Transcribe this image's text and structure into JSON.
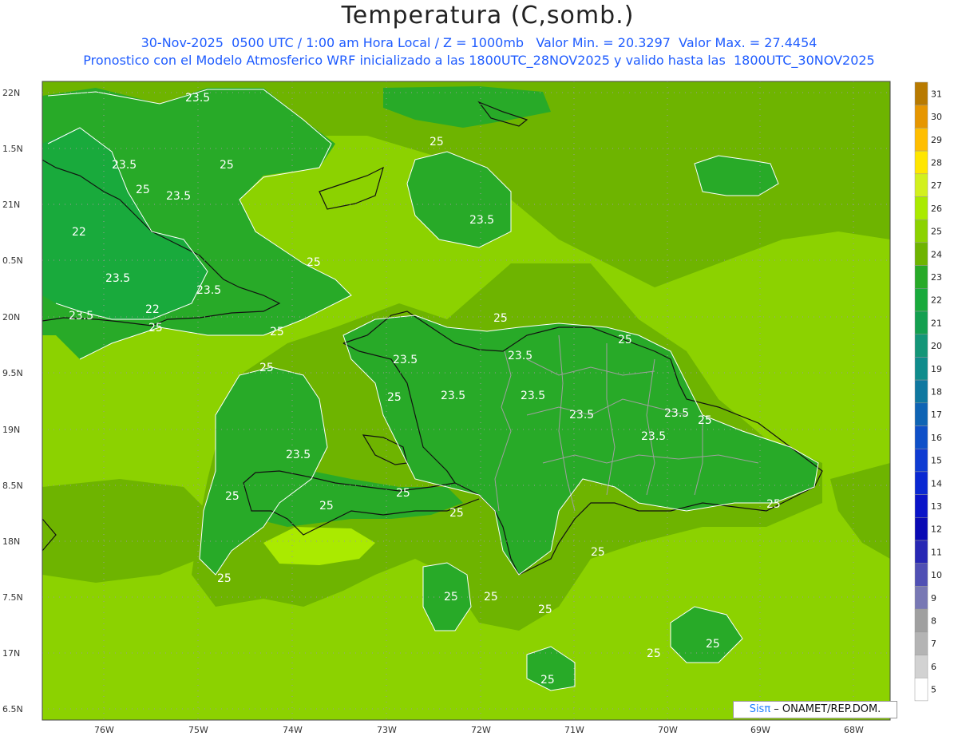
{
  "header": {
    "title": "Temperatura (C,somb.)",
    "line1": "30-Nov-2025  0500 UTC / 1:00 am Hora Local / Z = 1000mb   Valor Min. = 20.3297  Valor Max. = 27.4454",
    "line2": "Pronostico con el Modelo Atmosferico WRF inicializado a las 1800UTC_28NOV2025 y valido hasta las  1800UTC_30NOV2025"
  },
  "axes": {
    "lat_labels": [
      "22N",
      "1.5N",
      "21N",
      "0.5N",
      "20N",
      "9.5N",
      "19N",
      "8.5N",
      "18N",
      "7.5N",
      "17N",
      "6.5N"
    ],
    "lon_labels": [
      "76W",
      "75W",
      "74W",
      "73W",
      "72W",
      "71W",
      "70W",
      "69W",
      "68W"
    ]
  },
  "colorbar": {
    "labels": [
      "31",
      "30",
      "29",
      "28",
      "27",
      "26",
      "25",
      "24",
      "23",
      "22",
      "21",
      "20",
      "19",
      "18",
      "17",
      "16",
      "15",
      "14",
      "13",
      "12",
      "11",
      "10",
      "9",
      "8",
      "7",
      "6",
      "5"
    ],
    "colors": [
      "#b87a00",
      "#e69600",
      "#ffbe00",
      "#ffe600",
      "#d2f01e",
      "#aaea00",
      "#8cd200",
      "#6eb400",
      "#28aa28",
      "#19aa3c",
      "#14a050",
      "#149678",
      "#0f8c8c",
      "#0f78a0",
      "#0f64b4",
      "#0f50c8",
      "#0f3cd2",
      "#0a28d2",
      "#0a14c8",
      "#0a0ab4",
      "#2828b4",
      "#5050b4",
      "#7878b4",
      "#a0a0a0",
      "#b4b4b4",
      "#d2d2d2",
      "#ffffff"
    ]
  },
  "legend": {
    "low_color": "#6eb400",
    "mid_color": "#8cd200",
    "high_color": "#aaea00",
    "cool_color": "#28aa28",
    "coolest_color": "#19aa3c"
  },
  "contour_labels": [
    "23.5",
    "25",
    "22"
  ],
  "credit": {
    "brand": "Sisπ",
    "text": " – ONAMET/REP.DOM."
  }
}
